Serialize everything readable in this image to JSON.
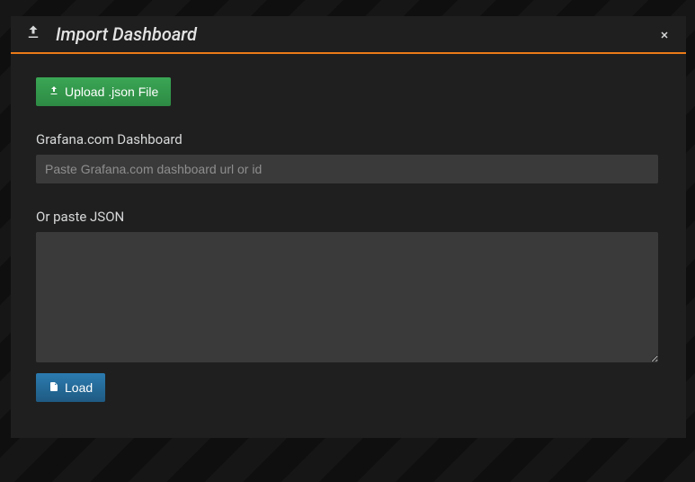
{
  "dialog": {
    "title": "Import Dashboard"
  },
  "upload": {
    "button_label": "Upload .json File"
  },
  "grafana": {
    "label": "Grafana.com Dashboard",
    "placeholder": "Paste Grafana.com dashboard url or id",
    "value": ""
  },
  "json": {
    "label": "Or paste JSON",
    "value": ""
  },
  "load": {
    "button_label": "Load"
  }
}
